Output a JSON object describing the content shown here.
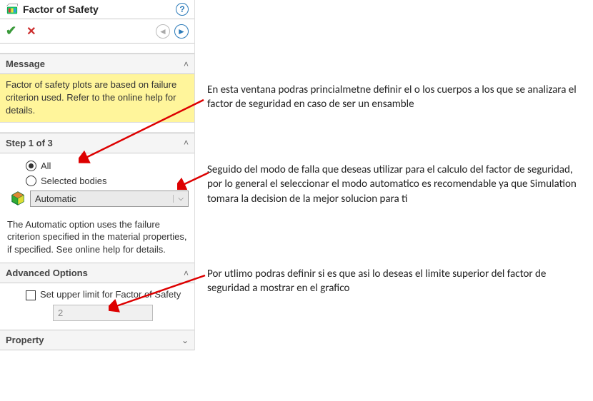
{
  "header": {
    "title": "Factor of Safety"
  },
  "sections": {
    "message": {
      "title": "Message",
      "body": "Factor of safety plots are based on failure criterion used. Refer to the online help for details."
    },
    "step": {
      "title": "Step 1 of 3",
      "option_all": "All",
      "option_selected": "Selected bodies",
      "dropdown_value": "Automatic",
      "hint": "The Automatic option uses the failure criterion specified in the material properties, if specified. See online help for details."
    },
    "advanced": {
      "title": "Advanced Options",
      "checkbox_label": "Set upper limit for Factor of Safety",
      "upper_limit_value": "2"
    },
    "property": {
      "title": "Property"
    }
  },
  "annotations": {
    "a1": "En esta ventana podras princialmetne definir el o los cuerpos a los que se analizara el factor de seguridad en caso de ser un ensamble",
    "a2": "Seguido del modo de falla que deseas utilizar para el calculo del factor de seguridad, por lo general el seleccionar el modo automatico es recomendable ya que Simulation tomara la decision de la mejor solucion para ti",
    "a3": "Por utlimo podras definir si es que asi lo deseas el limite superior del factor de seguridad a mostrar en el grafico"
  }
}
